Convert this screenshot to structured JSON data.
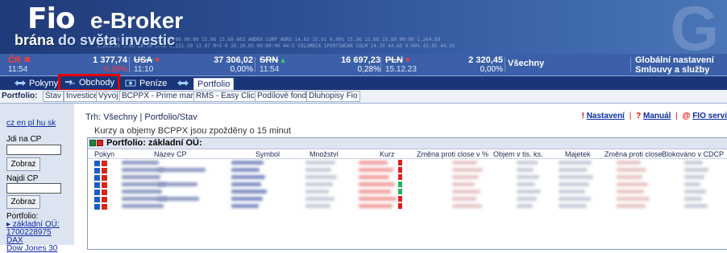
{
  "banner": {
    "logo_fio": "Fio",
    "logo_ebroker": "e-Broker",
    "tagline_part1": "brána ",
    "tagline_part2": "do světa investic",
    "ticker_rows": [
      "1,264.80 17,78 M+5 0  26.10.06 00:00 15.98 15.60 603 ANDRX CORP ADRX 14.02 15.91 0.00% 15.96 15.68 25.80 00:00 1,264.80",
      "1,200.00 5.00 28.00 0.00 2,221.50 13.07 M+5 0 26.10.05 00:00:00 44.5 COLUMBIA SPORTSWEAR COLM 14.39 44.65 0.00% 43.85 44.56"
    ]
  },
  "indices": [
    {
      "name": "ČR",
      "time": "11:54",
      "value": "1 377,74",
      "change": "-0,30%",
      "dir": "down"
    },
    {
      "name": "USA",
      "time": "11:10",
      "value": "37 306,02",
      "change": "0,00%",
      "dir": "down"
    },
    {
      "name": "SRN",
      "time": "11:54",
      "value": "16 697,23",
      "change": "0,28%",
      "dir": "up"
    },
    {
      "name": "PLN",
      "time": "15.12.23",
      "value": "2 320,45",
      "change": "0,00%",
      "dir": "down"
    }
  ],
  "strip_all": "Všechny",
  "strip_global": {
    "line1": "Globální nastavení",
    "line2": "Smlouvy a služby"
  },
  "mainnav": {
    "pokyny": "Pokyny",
    "obchody": "Obchody",
    "penize": "Peníze",
    "portfolio": "Portfolio"
  },
  "subnav": {
    "label": "Portfolio:",
    "items": [
      "Stav",
      "Investice",
      "Vývoj",
      "BCPPX - Prime market",
      "RMS - Easy Click",
      "Podílové fondy",
      "Dluhopisy Fio"
    ]
  },
  "sidebar": {
    "langs": "cz en pl hu sk",
    "jdi_na_cp": "Jdi na CP",
    "zobraz1": "Zobraz",
    "najdi_cp": "Najdi CP",
    "zobraz2": "Zobraz",
    "portfolio_label": "Portfolio:",
    "portfolio_item": "▸ základní OÚ:",
    "account": "1700228975",
    "dax": "DAX",
    "dow": "Dow Jones 30"
  },
  "content": {
    "trh": "Trh: Všechny | Portfolio/Stav",
    "links": {
      "nastaveni": "Nastavení",
      "manual": "Manuál",
      "fio": "FIO servi"
    },
    "note": "Kurzy a objemy BCPPX jsou zpožděny o 15 minut",
    "table_title": "Portfolio: základní OÚ:",
    "headers": [
      "Pokyn",
      "Název CP",
      "Symbol",
      "Množství",
      "Kurz",
      "Změna proti close v %",
      "Objem v tis. ks.",
      "Majetek",
      "Změna proti close",
      "Blokováno v CDCP"
    ]
  },
  "rows": [
    {
      "marker": "r"
    },
    {
      "marker": "r"
    },
    {
      "marker": "r"
    },
    {
      "marker": "g"
    },
    {
      "marker": "g"
    },
    {
      "marker": "r"
    },
    {
      "marker": "r"
    }
  ],
  "colors": {
    "banner": "#1f3a78",
    "nav": "#1a357a",
    "strip": "#3b5fa8",
    "highlight": "#e60000"
  }
}
